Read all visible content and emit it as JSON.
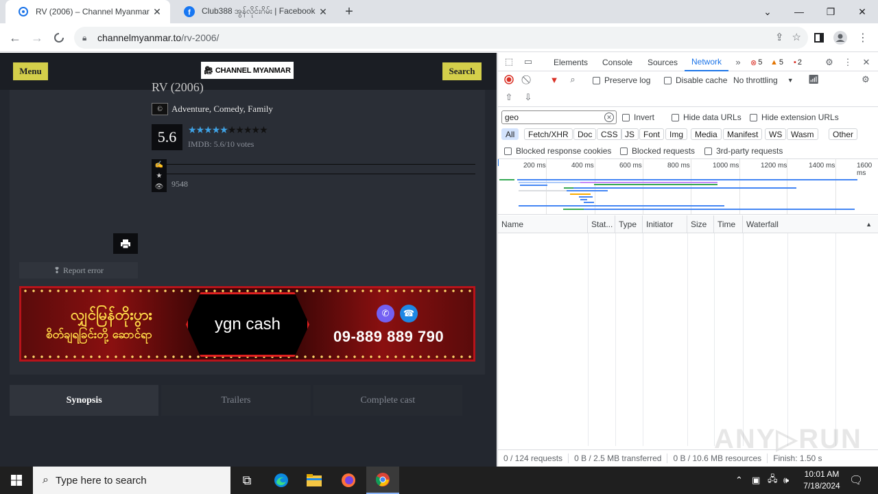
{
  "browser": {
    "tabs": [
      {
        "title": "RV (2006) – Channel Myanmar",
        "active": true
      },
      {
        "title": "Club388 အွန်လိုင်းဂိမ်း | Facebook",
        "active": false
      }
    ],
    "new_tab_label": "+",
    "url_host": "channelmyanmar.to",
    "url_path": "/rv-2006/"
  },
  "site": {
    "menu_label": "Menu",
    "logo_text": "CHANNEL MYANMAR",
    "search_label": "Search",
    "movie_title": "RV (2006)",
    "genres": "Adventure, Comedy, Family",
    "rating": "5.6",
    "stars_on": 5,
    "stars_total": 10,
    "imdb_text": "IMDB: 5.6/10  votes",
    "views": "9548",
    "report_label": "Report error",
    "banner": {
      "left_text_line1": "လျှင်မြန်တိုးပွား",
      "left_text_line2": "စိတ်ချရခြင်းတို့ ဆောင်ရာ",
      "brand": "ygn cash",
      "phone": "09-889 889 790"
    },
    "tabs": [
      "Synopsis",
      "Trailers",
      "Complete cast"
    ]
  },
  "devtools": {
    "tabs": [
      "Elements",
      "Console",
      "Sources",
      "Network"
    ],
    "active_tab": "Network",
    "error_count": "5",
    "warning_count": "5",
    "issue_count": "2",
    "preserve_log": "Preserve log",
    "disable_cache": "Disable cache",
    "throttling": "No throttling",
    "filter_value": "geo",
    "invert": "Invert",
    "hide_data_urls": "Hide data URLs",
    "hide_extension_urls": "Hide extension URLs",
    "type_filters": [
      "All",
      "Fetch/XHR",
      "Doc",
      "CSS",
      "JS",
      "Font",
      "Img",
      "Media",
      "Manifest",
      "WS",
      "Wasm",
      "Other"
    ],
    "blocked_cookies": "Blocked response cookies",
    "blocked_requests": "Blocked requests",
    "third_party": "3rd-party requests",
    "timeline_ticks": [
      "200 ms",
      "400 ms",
      "600 ms",
      "800 ms",
      "1000 ms",
      "1200 ms",
      "1400 ms",
      "1600 ms"
    ],
    "columns": [
      "Name",
      "Stat...",
      "Type",
      "Initiator",
      "Size",
      "Time",
      "Waterfall"
    ],
    "status": {
      "requests": "0 / 124 requests",
      "transferred": "0 B / 2.5 MB transferred",
      "resources": "0 B / 10.6 MB resources",
      "finish": "Finish: 1.50 s"
    }
  },
  "taskbar": {
    "search_placeholder": "Type here to search",
    "time": "10:01 AM",
    "date": "7/18/2024"
  },
  "colors": {
    "site_bg": "#23272f",
    "accent_yellow": "#d4cf4a",
    "devtools_blue": "#1a73e8",
    "star_blue": "#3fa3e6"
  }
}
